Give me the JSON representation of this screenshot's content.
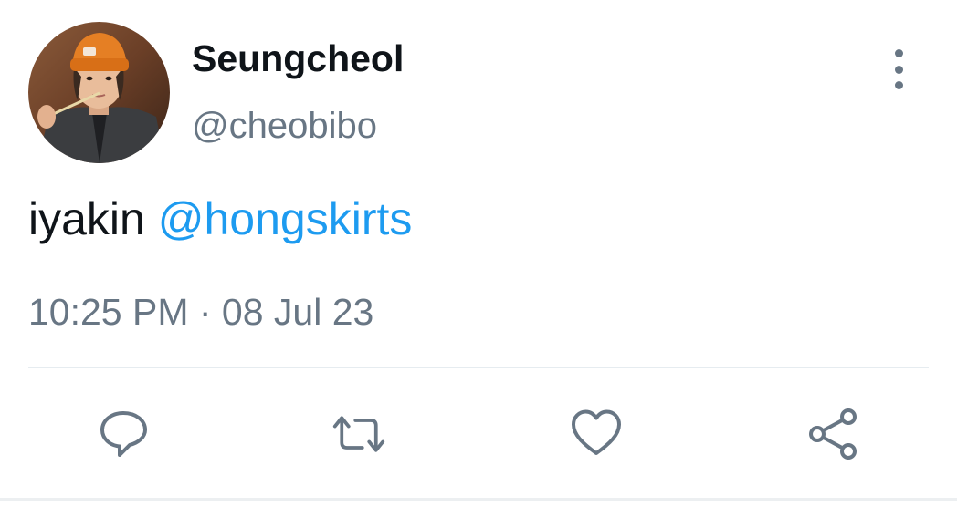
{
  "tweet": {
    "display_name": "Seungcheol",
    "handle": "@cheobibo",
    "text_prefix": "iyakin ",
    "mention": "@hongskirts",
    "timestamp": "10:25 PM · 08 Jul 23"
  },
  "icons": {
    "more": "more-vertical-icon",
    "reply": "reply-icon",
    "retweet": "retweet-icon",
    "like": "heart-icon",
    "share": "share-icon"
  },
  "colors": {
    "text": "#0f1419",
    "secondary": "#687684",
    "link": "#1d9bf0",
    "divider": "#e6ecf0"
  }
}
